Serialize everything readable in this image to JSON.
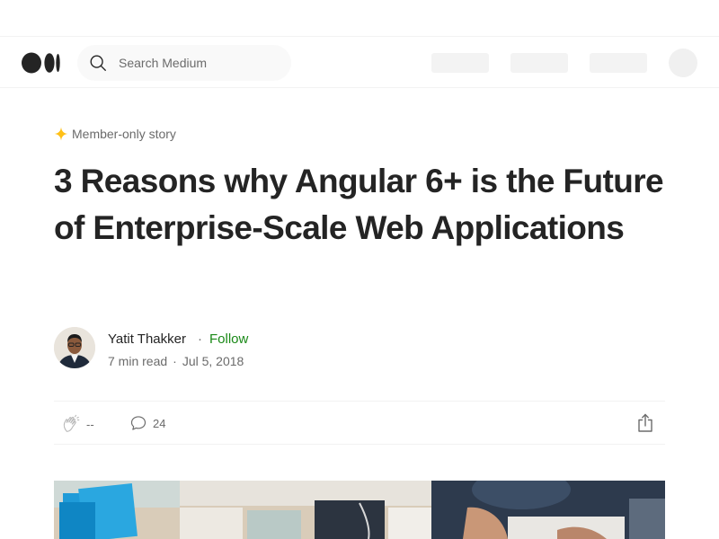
{
  "search": {
    "placeholder": "Search Medium"
  },
  "article": {
    "member_label": "Member-only story",
    "title": "3 Reasons why Angular 6+ is the Future of Enterprise-Scale Web Applications",
    "author": {
      "name": "Yatit Thakker",
      "follow_label": "Follow",
      "separator": "·"
    },
    "meta": {
      "read_time": "7 min read",
      "separator": "·",
      "date": "Jul 5, 2018"
    },
    "actions": {
      "claps": "--",
      "responses": "24"
    }
  },
  "icons": {
    "logo": "medium-logo-icon",
    "search": "search-icon",
    "member": "star-icon",
    "clap": "clap-icon",
    "response": "speech-bubble-icon",
    "share": "share-icon"
  },
  "colors": {
    "accent_follow": "#1a8917",
    "member_star": "#ffc017",
    "text_primary": "#242424",
    "text_secondary": "#6b6b6b"
  }
}
